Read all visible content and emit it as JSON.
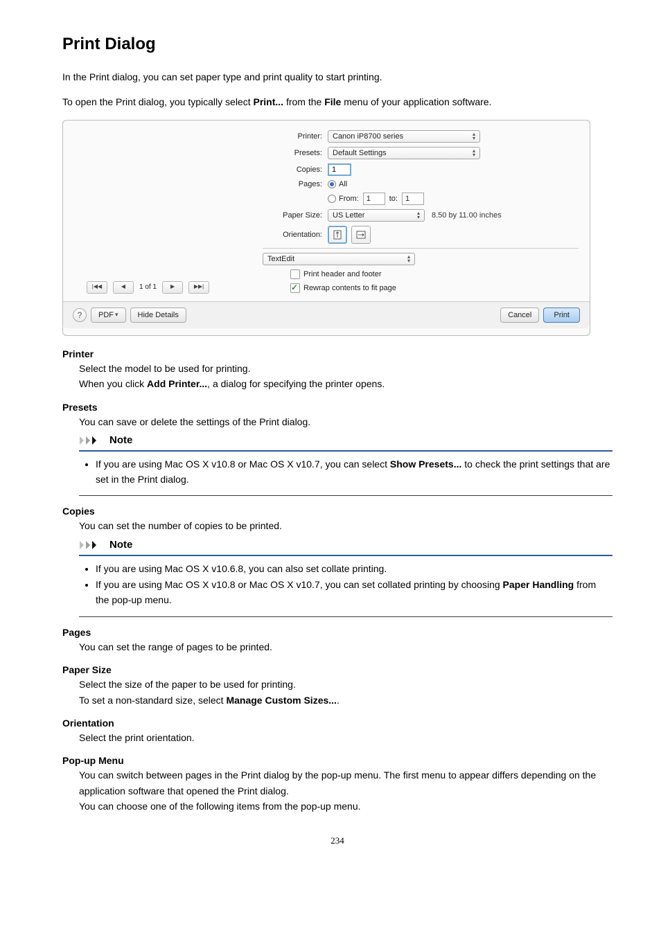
{
  "heading": "Print Dialog",
  "intro1_a": "In the Print dialog, you can set paper type and print quality to start printing.",
  "intro2_a": "To open the Print dialog, you typically select ",
  "intro2_b": "Print...",
  "intro2_c": " from the ",
  "intro2_d": "File",
  "intro2_e": " menu of your application software.",
  "dialog": {
    "printer_label": "Printer:",
    "printer_value": "Canon iP8700 series",
    "presets_label": "Presets:",
    "presets_value": "Default Settings",
    "copies_label": "Copies:",
    "copies_value": "1",
    "pages_label": "Pages:",
    "pages_all": "All",
    "from_label": "From:",
    "from_value": "1",
    "to_label": "to:",
    "to_value": "1",
    "papersize_label": "Paper Size:",
    "papersize_value": "US Letter",
    "papersize_dim": "8.50 by 11.00 inches",
    "orientation_label": "Orientation:",
    "section_value": "TextEdit",
    "chk_header": "Print header and footer",
    "chk_rewrap": "Rewrap contents to fit page",
    "pagecount": "1 of 1",
    "help": "?",
    "pdf": "PDF",
    "hide": "Hide Details",
    "cancel": "Cancel",
    "print": "Print"
  },
  "defs": {
    "printer_t": "Printer",
    "printer_d1": "Select the model to be used for printing.",
    "printer_d2a": "When you click ",
    "printer_d2b": "Add Printer...",
    "printer_d2c": ", a dialog for specifying the printer opens.",
    "presets_t": "Presets",
    "presets_d": "You can save or delete the settings of the Print dialog.",
    "copies_t": "Copies",
    "copies_d": "You can set the number of copies to be printed.",
    "pages_t": "Pages",
    "pages_d": "You can set the range of pages to be printed.",
    "papersize_t": "Paper Size",
    "papersize_d1": "Select the size of the paper to be used for printing.",
    "papersize_d2a": "To set a non-standard size, select ",
    "papersize_d2b": "Manage Custom Sizes...",
    "papersize_d2c": ".",
    "orientation_t": "Orientation",
    "orientation_d": "Select the print orientation.",
    "popup_t": "Pop-up Menu",
    "popup_d1": "You can switch between pages in the Print dialog by the pop-up menu. The first menu to appear differs depending on the application software that opened the Print dialog.",
    "popup_d2": "You can choose one of the following items from the pop-up menu."
  },
  "note_label": "Note",
  "note1_a": "If you are using Mac OS X v10.8 or Mac OS X v10.7, you can select ",
  "note1_b": "Show Presets...",
  "note1_c": " to check the print settings that are set in the Print dialog.",
  "note2_li1": "If you are using Mac OS X v10.6.8, you can also set collate printing.",
  "note2_li2a": "If you are using Mac OS X v10.8 or Mac OS X v10.7, you can set collated printing by choosing ",
  "note2_li2b": "Paper Handling",
  "note2_li2c": " from the pop-up menu.",
  "page_num": "234"
}
